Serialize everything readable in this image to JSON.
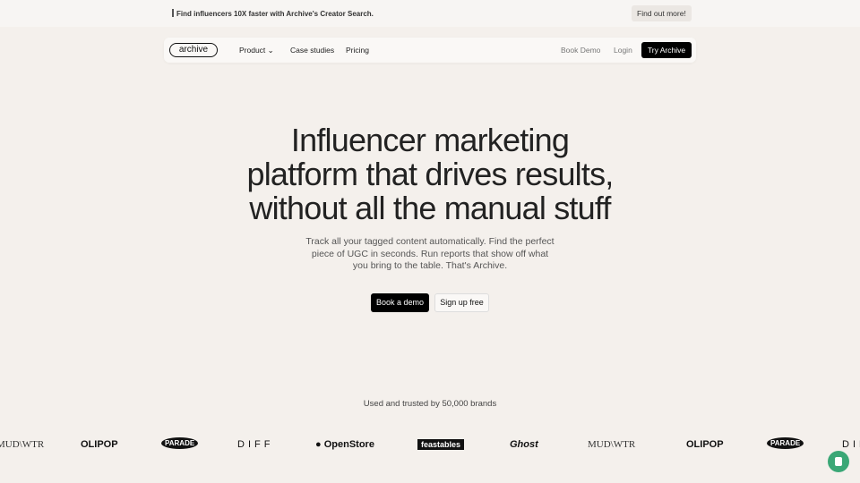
{
  "banner": {
    "message": "Find influencers 10X faster with Archive's Creator Search.",
    "cta": "Find out more!"
  },
  "nav": {
    "logo": "archive",
    "items": [
      "Product",
      "Case studies",
      "Pricing"
    ],
    "book_demo": "Book Demo",
    "login": "Login",
    "try": "Try Archive"
  },
  "hero": {
    "title": "Influencer marketing platform that drives results, without all the manual stuff",
    "subtitle": "Track all your tagged content automatically. Find the perfect piece of UGC in seconds. Run reports that show off what you bring to the table. That's Archive.",
    "primary": "Book a demo",
    "secondary": "Sign up free"
  },
  "trust": {
    "text": "Used and trusted by 50,000 brands",
    "logos": [
      "MUD\\WTR",
      "OLIPOP",
      "PARADE",
      "DIFF",
      "OpenStore",
      "feastables",
      "Ghost",
      "MUD\\WTR",
      "OLIPOP",
      "PARADE",
      "DIFF"
    ]
  },
  "colors": {
    "background": "#f4f0ec",
    "chat": "#3aa776"
  }
}
